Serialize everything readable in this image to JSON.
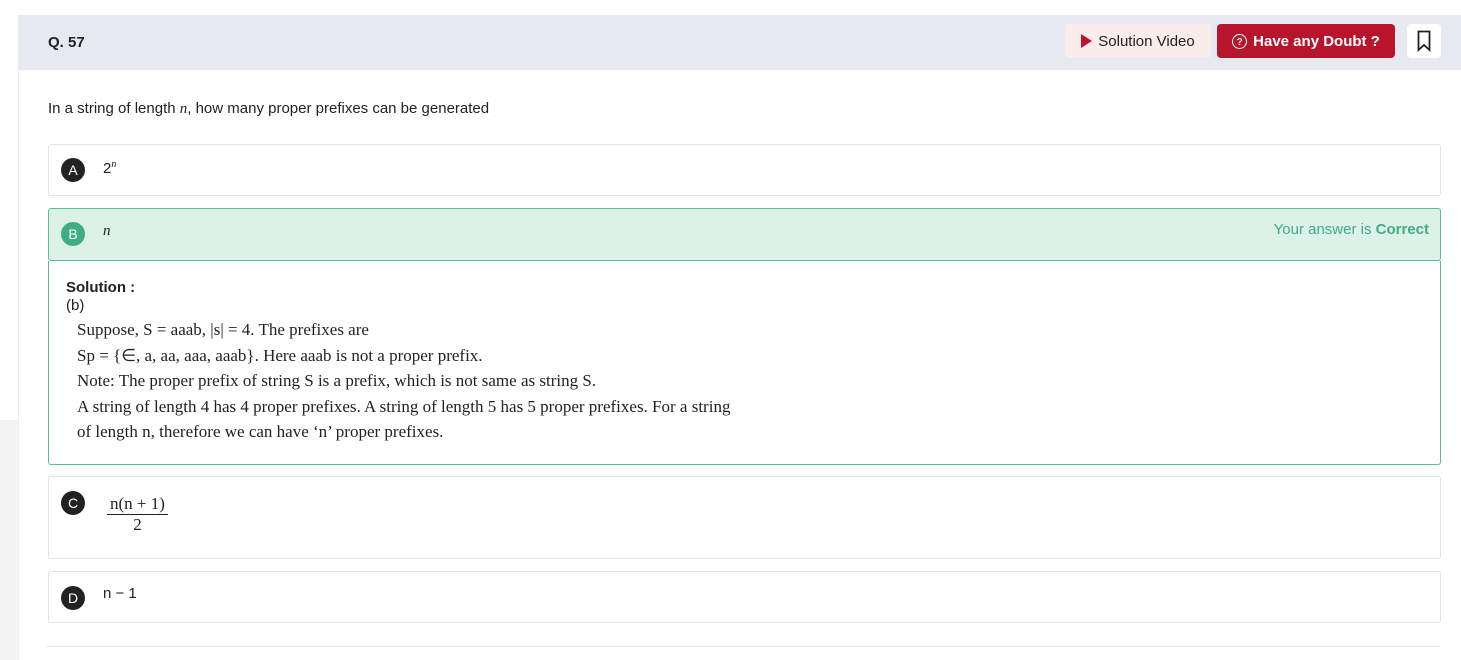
{
  "question_number": "Q. 57",
  "header": {
    "solution_video_label": "Solution Video",
    "doubt_label": "Have any Doubt ?",
    "accent_color": "#b8142b",
    "correct_color": "#3fae82"
  },
  "question": {
    "prefix": "In a string of length ",
    "var": "n",
    "suffix": ", how many proper prefixes can be generated"
  },
  "options": [
    {
      "letter": "A",
      "base": "2",
      "sup": "n"
    },
    {
      "letter": "B",
      "text": "n"
    },
    {
      "letter": "C",
      "numerator": "n(n + 1)",
      "denominator": "2"
    },
    {
      "letter": "D",
      "text": "n − 1"
    }
  ],
  "answer_status": {
    "prefix": "Your answer is ",
    "value": "Correct"
  },
  "solution": {
    "title": "Solution :",
    "answer": "(b)",
    "lines": [
      "Suppose, S = aaab, |s| = 4. The prefixes are",
      "Sp = {∈, a, aa, aaa, aaab}. Here aaab is not a proper prefix.",
      "Note: The proper prefix of string S is a prefix, which is not same as string S.",
      "A string of length 4 has 4 proper prefixes. A string of length 5 has 5 proper prefixes. For a string",
      "of length n, therefore we can have ‘n’ proper prefixes."
    ]
  }
}
